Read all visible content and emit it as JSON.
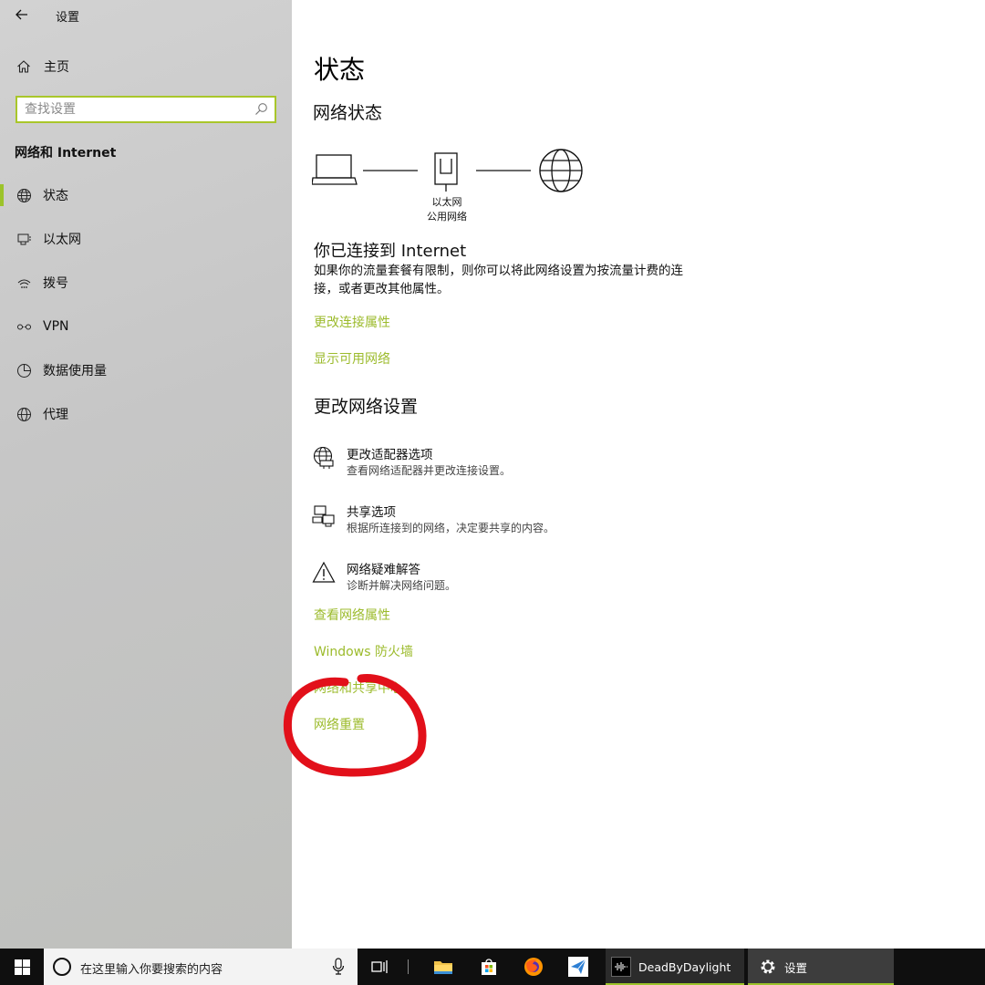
{
  "window": {
    "title": "设置"
  },
  "sidebar": {
    "home_label": "主页",
    "search_placeholder": "查找设置",
    "section_title": "网络和 Internet",
    "items": [
      {
        "label": "状态",
        "icon": "globe-icon",
        "active": true
      },
      {
        "label": "以太网",
        "icon": "ethernet-icon",
        "active": false
      },
      {
        "label": "拨号",
        "icon": "dialup-icon",
        "active": false
      },
      {
        "label": "VPN",
        "icon": "vpn-icon",
        "active": false
      },
      {
        "label": "数据使用量",
        "icon": "data-usage-icon",
        "active": false
      },
      {
        "label": "代理",
        "icon": "proxy-globe-icon",
        "active": false
      }
    ]
  },
  "main": {
    "page_title": "状态",
    "network_status_heading": "网络状态",
    "diagram": {
      "adapter_label": "以太网",
      "network_label": "公用网络"
    },
    "connected_title": "你已连接到 Internet",
    "connected_desc": "如果你的流量套餐有限制，则你可以将此网络设置为按流量计费的连接，或者更改其他属性。",
    "links_top": [
      "更改连接属性",
      "显示可用网络"
    ],
    "change_heading": "更改网络设置",
    "options": [
      {
        "title": "更改适配器选项",
        "desc": "查看网络适配器并更改连接设置。",
        "icon": "adapter-icon"
      },
      {
        "title": "共享选项",
        "desc": "根据所连接到的网络，决定要共享的内容。",
        "icon": "sharing-icon"
      },
      {
        "title": "网络疑难解答",
        "desc": "诊断并解决网络问题。",
        "icon": "warning-icon"
      }
    ],
    "links_bottom": [
      "查看网络属性",
      "Windows 防火墙",
      "网络和共享中心",
      "网络重置"
    ]
  },
  "taskbar": {
    "search_placeholder": "在这里输入你要搜索的内容",
    "apps": [
      {
        "label": "DeadByDaylight"
      },
      {
        "label": "设置"
      }
    ]
  },
  "colors": {
    "accent": "#9cc32a",
    "link": "#9cbb2c",
    "annotation": "#e2101a"
  }
}
